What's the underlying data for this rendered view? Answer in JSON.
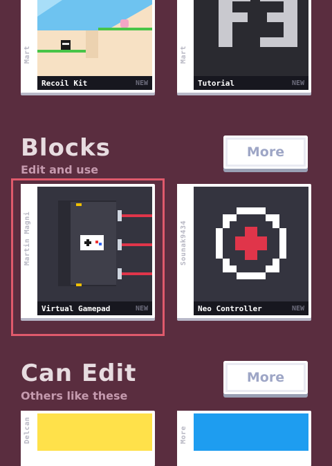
{
  "top_cards": [
    {
      "author": "Mart",
      "title": "Recoil Kit",
      "badge": "NEW"
    },
    {
      "author": "Mart",
      "title": "Tutorial",
      "badge": "NEW"
    }
  ],
  "blocks": {
    "title": "Blocks",
    "subtitle": "Edit and use",
    "more_label": "More",
    "cards": [
      {
        "author": "Martin Magni",
        "title": "Virtual Gamepad",
        "badge": "NEW"
      },
      {
        "author": "Sounak9434",
        "title": "Neo Controller",
        "badge": "NEW"
      }
    ]
  },
  "can_edit": {
    "title": "Can Edit",
    "subtitle": "Others like these",
    "more_label": "More",
    "cards": [
      {
        "author": "Delcan"
      },
      {
        "author": "More"
      }
    ]
  },
  "colors": {
    "background": "#5a2d3f",
    "selection": "#e05a6c"
  }
}
